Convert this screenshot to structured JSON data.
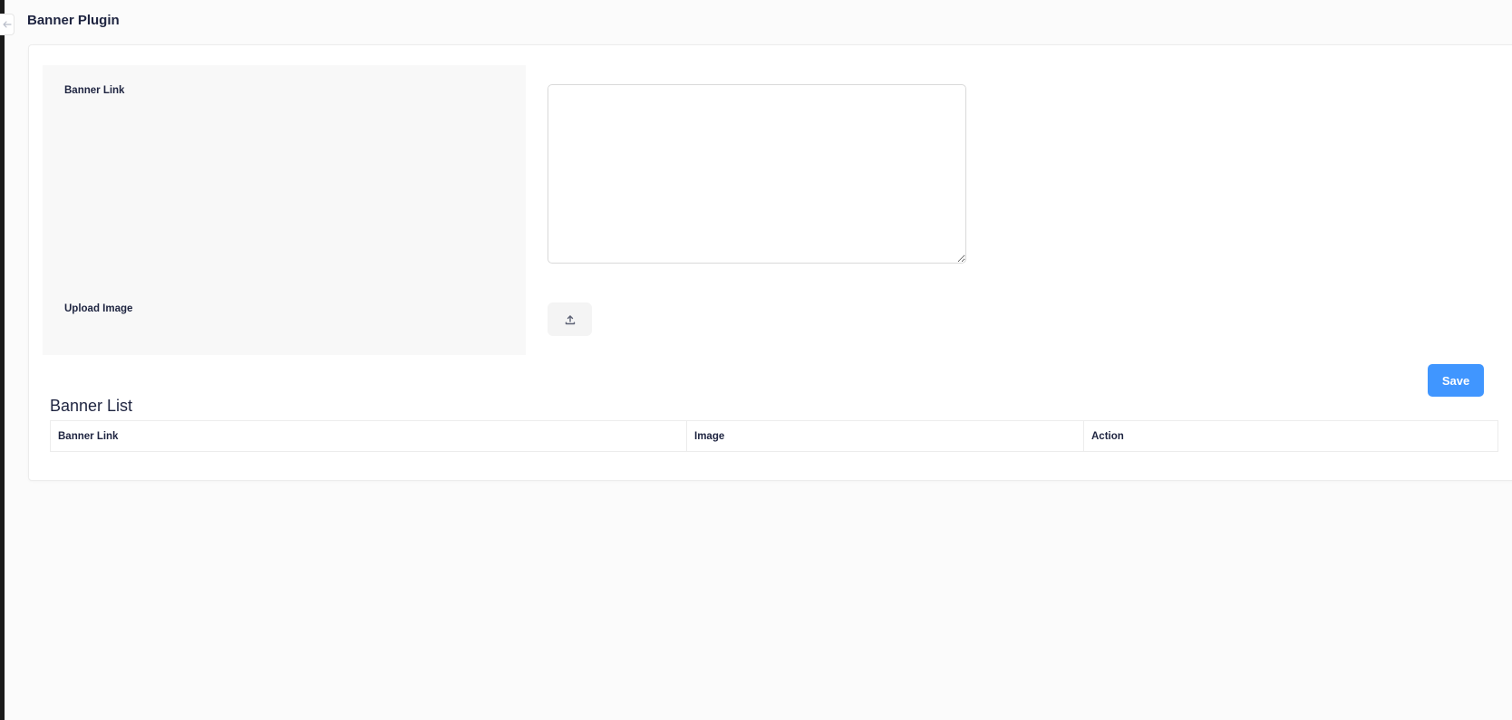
{
  "page": {
    "title": "Banner Plugin"
  },
  "form": {
    "banner_link_label": "Banner Link",
    "banner_link_value": "",
    "upload_image_label": "Upload Image",
    "save_label": "Save"
  },
  "banner_list": {
    "title": "Banner List",
    "columns": [
      "Banner Link",
      "Image",
      "Action"
    ],
    "rows": []
  },
  "icons": {
    "toggle": "arrow-left-icon",
    "upload": "upload-icon"
  },
  "colors": {
    "primary": "#4096ff",
    "text": "#1e2440",
    "panel": "#f8f8f8",
    "border": "#ececec"
  }
}
